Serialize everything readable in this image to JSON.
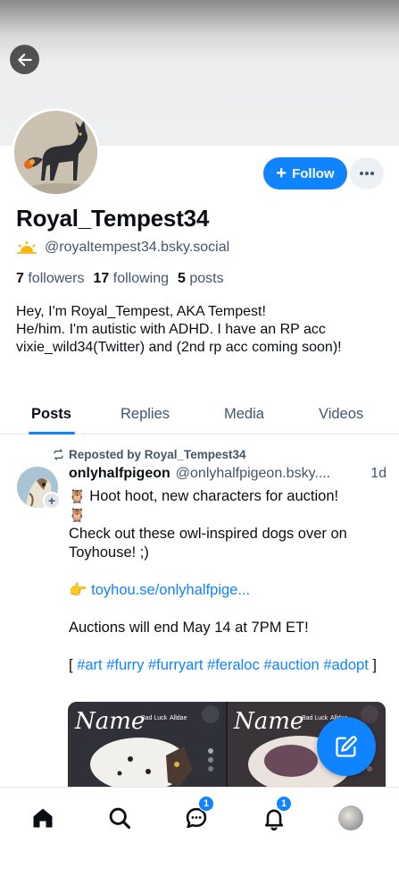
{
  "profile": {
    "display_name": "Royal_Tempest34",
    "handle": "@royaltempest34.bsky.social",
    "followers_count": "7",
    "followers_label": "followers",
    "following_count": "17",
    "following_label": "following",
    "posts_count": "5",
    "posts_label": "posts",
    "bio_line1": "Hey, I'm Royal_Tempest, AKA Tempest!",
    "bio_line2": "He/him. I'm autistic with ADHD. I have an RP acc vixie_wild34(Twitter) and (2nd rp acc coming soon)!",
    "follow_label": "Follow"
  },
  "tabs": [
    {
      "label": "Posts",
      "active": true
    },
    {
      "label": "Replies",
      "active": false
    },
    {
      "label": "Media",
      "active": false
    },
    {
      "label": "Videos",
      "active": false
    }
  ],
  "post": {
    "repost_label": "Reposted by Royal_Tempest34",
    "author": "onlyhalfpigeon",
    "handle": "@onlyhalfpigeon.bsky....",
    "time": "1d",
    "line1": "Hoot hoot, new characters for auction!",
    "line2": "Check out these owl-inspired dogs over on Toyhouse! ;)",
    "link_prefix": "👉",
    "link": "toyhou.se/onlyhalfpige...",
    "line3": "Auctions will end May 14 at 7PM ET!",
    "tags_open": "[",
    "tags": [
      "#art",
      "#furry",
      "#furryart",
      "#feraloc",
      "#auction",
      "#adopt"
    ],
    "tags_close": "]",
    "image_left_title": "Name",
    "image_left_sub1": "Bad Luck",
    "image_left_sub2": "Alldae",
    "image_right_title": "Name",
    "image_right_sub1": "Bad Luck",
    "image_right_sub2": "Alldae"
  },
  "nav": {
    "messages_badge": "1",
    "notifications_badge": "1"
  },
  "colors": {
    "accent": "#1083fe",
    "muted_text": "#42576c"
  }
}
